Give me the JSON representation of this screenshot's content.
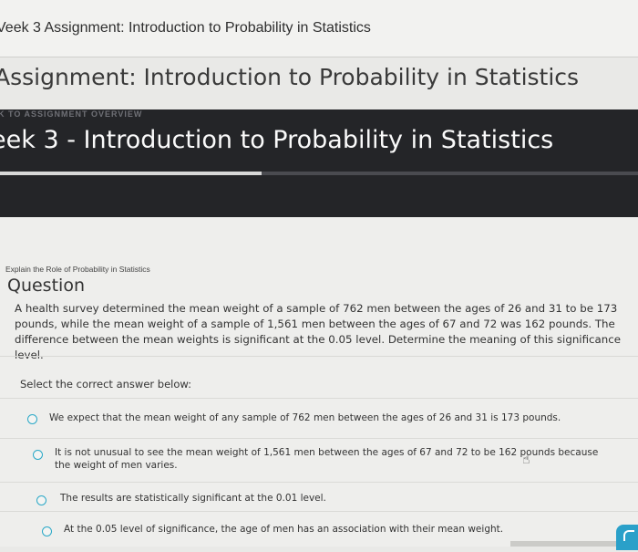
{
  "window": {
    "title": "Veek 3 Assignment: Introduction to Probability in Statistics"
  },
  "assignment": {
    "heading": "Assignment: Introduction to Probability in Statistics"
  },
  "banner": {
    "overview_label": "K TO ASSIGNMENT OVERVIEW",
    "title": "eek 3 - Introduction to Probability in Statistics",
    "progress_fraction": 0.41
  },
  "question": {
    "breadcrumb": "Explain the Role of Probability in Statistics",
    "heading": "Question",
    "text": "A health survey determined the mean weight of a sample of 762 men between the ages of 26 and 31 to be 173 pounds, while the mean weight of a sample of 1,561 men between the ages of 67 and 72 was 162 pounds. The difference between the mean weights is significant at the 0.05 level. Determine the meaning of this significance level.",
    "select_label": "Select the correct answer below:",
    "options": [
      {
        "label": "We expect that the mean weight of any sample of 762 men between the ages of 26 and 31 is 173 pounds."
      },
      {
        "label_line1": "It is not unusual to see the mean weight of 1,561 men between the ages of 67 and 72 to be 162 pounds because",
        "label_line2": "the weight of men varies."
      },
      {
        "label": "The results are statistically significant at the 0.01 level."
      },
      {
        "label": "At the 0.05 level of significance, the age of men has an association with their mean weight."
      }
    ]
  },
  "colors": {
    "accent": "#2aa8c7",
    "banner_bg": "#242528"
  },
  "icons": {
    "cursor": "hand-pointer-icon",
    "corner_button": "feedback-icon"
  }
}
